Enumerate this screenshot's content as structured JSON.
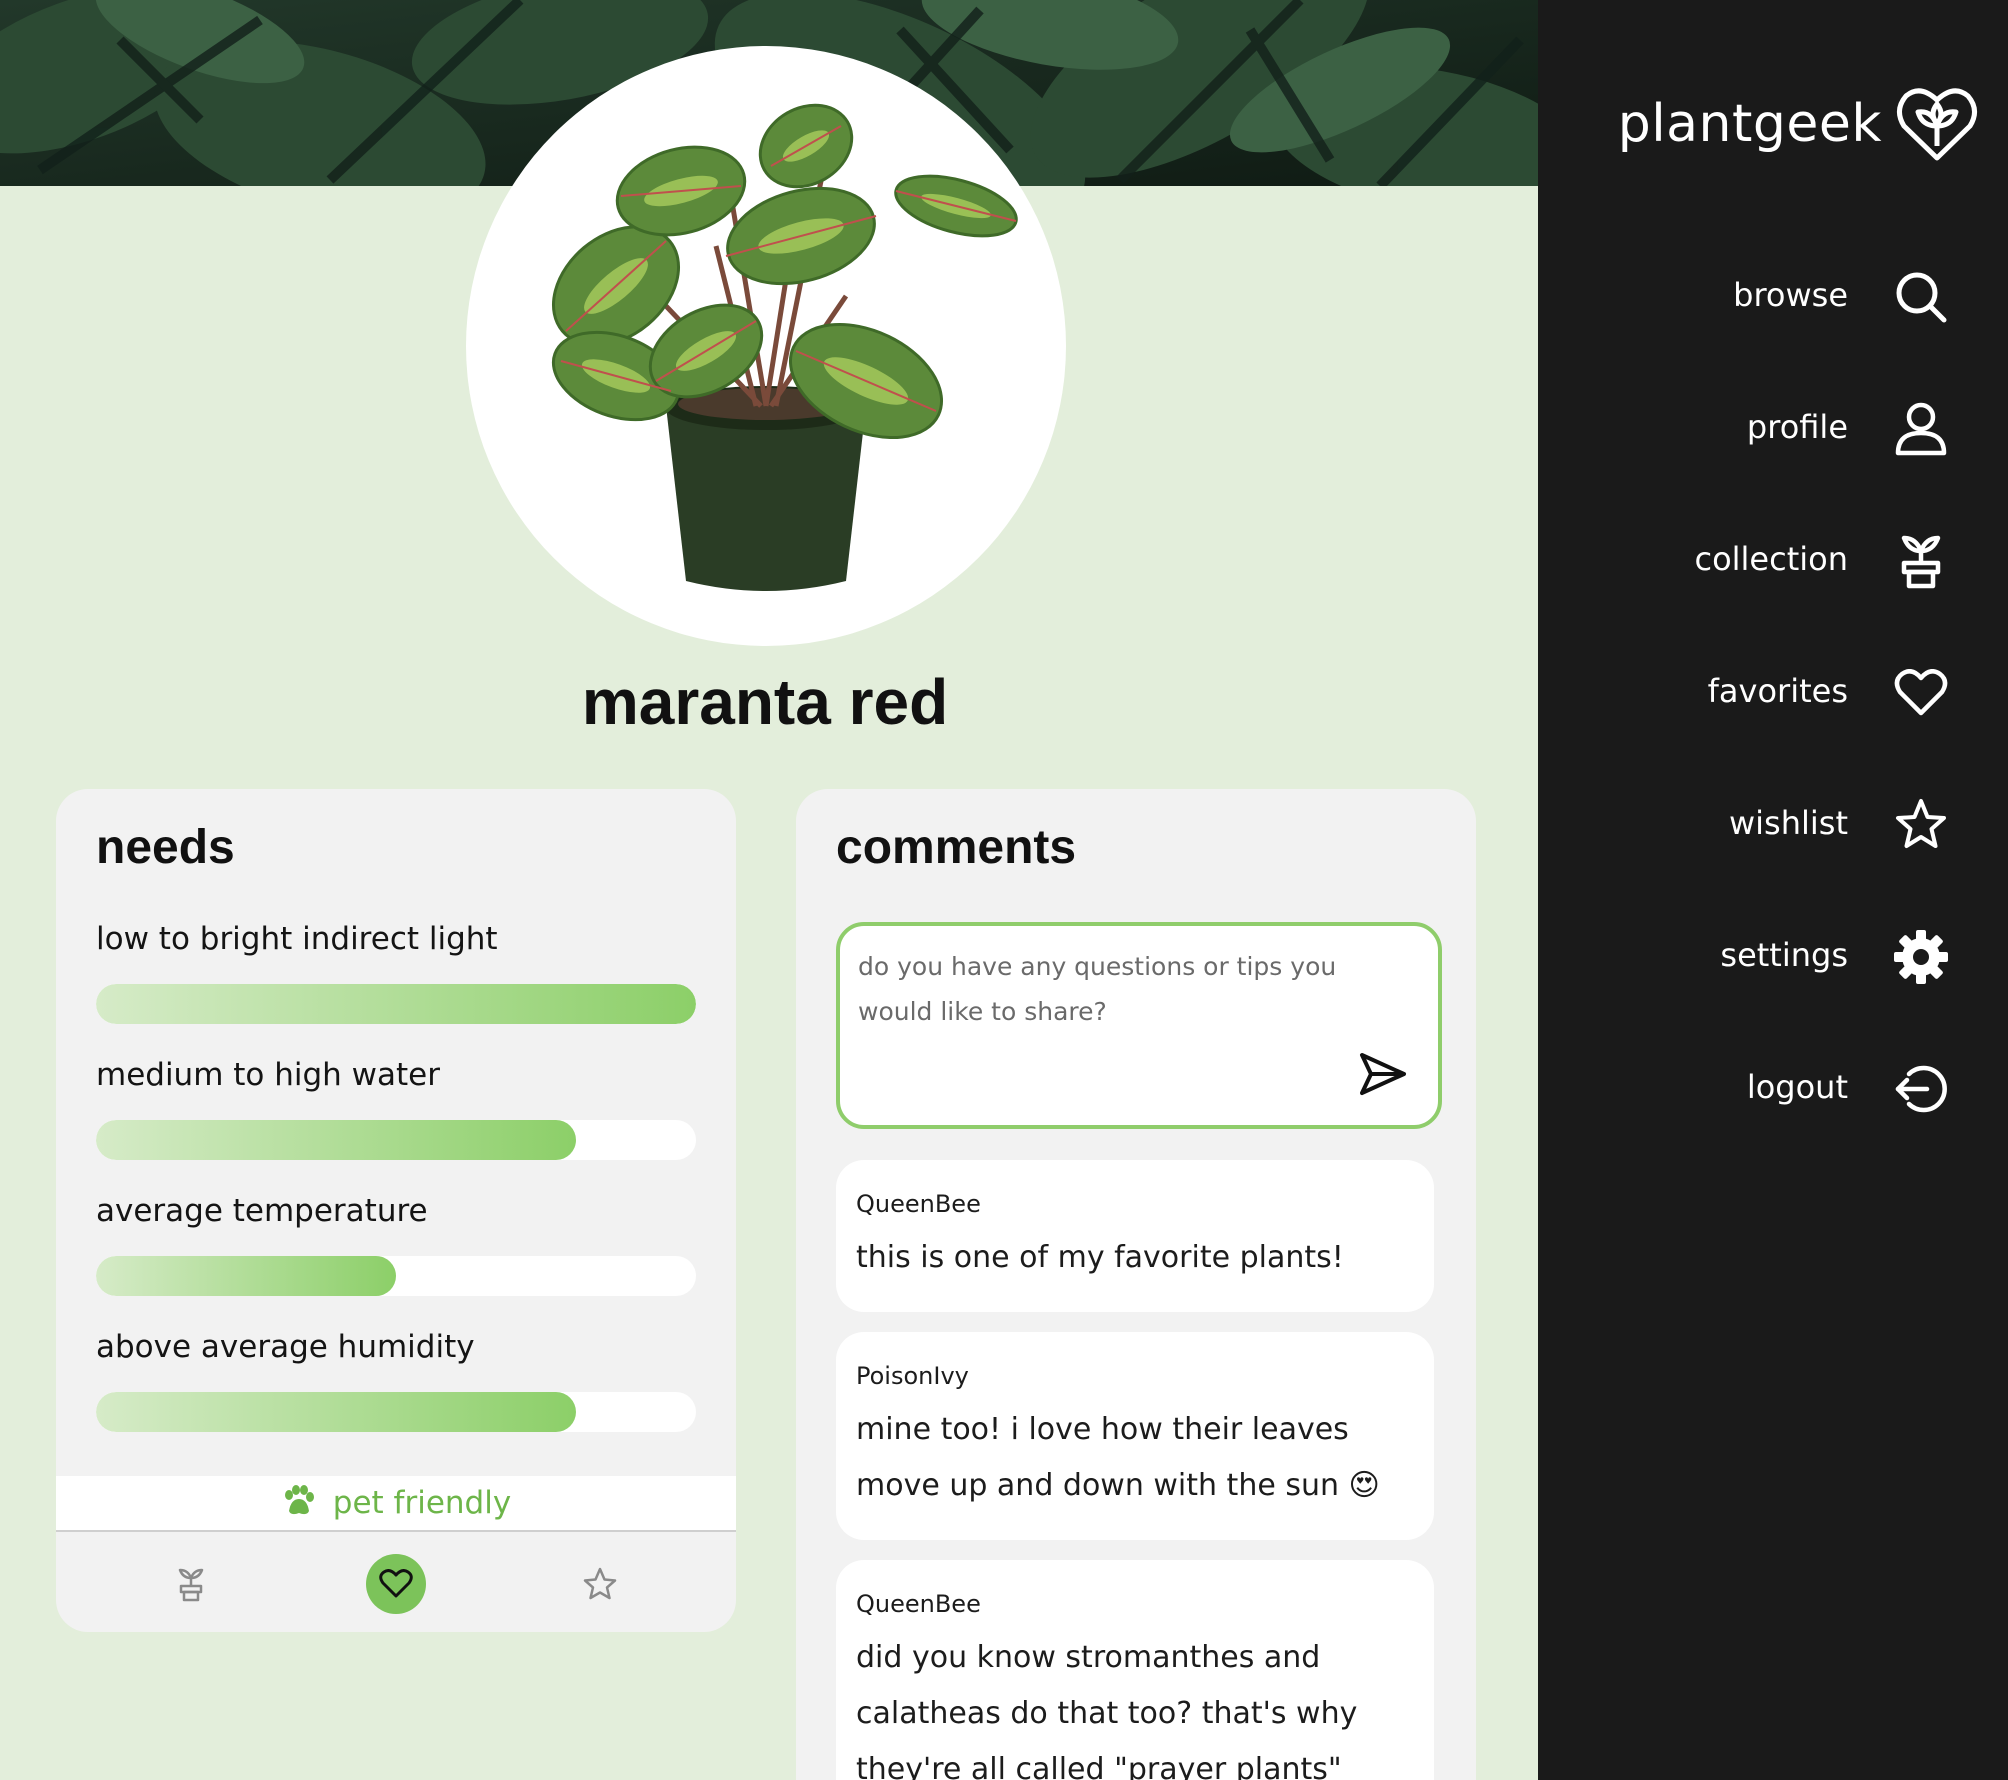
{
  "plant": {
    "name": "maranta red"
  },
  "needs": {
    "heading": "needs",
    "items": [
      {
        "label": "low to bright indirect light",
        "level": 1.0
      },
      {
        "label": "medium to high water",
        "level": 0.8
      },
      {
        "label": "average temperature",
        "level": 0.5
      },
      {
        "label": "above average humidity",
        "level": 0.8
      }
    ],
    "pet_friendly": "pet friendly",
    "actions": [
      {
        "name": "collection",
        "icon": "plant-pot-icon",
        "active": false
      },
      {
        "name": "favorites",
        "icon": "heart-icon",
        "active": true
      },
      {
        "name": "wishlist",
        "icon": "star-icon",
        "active": false
      }
    ]
  },
  "comments": {
    "heading": "comments",
    "placeholder": "do you have any questions or tips you would like to share?",
    "list": [
      {
        "author": "QueenBee",
        "text": "this is one of my favorite plants!"
      },
      {
        "author": "PoisonIvy",
        "text": "mine too! i love how their leaves move up and down with the sun 😍"
      },
      {
        "author": "QueenBee",
        "text": "did you know stromanthes and calatheas do that too? that's why they're all called \"prayer plants\""
      }
    ]
  },
  "sidebar": {
    "brand": "plantgeek",
    "items": [
      {
        "label": "browse",
        "icon": "search-icon"
      },
      {
        "label": "profile",
        "icon": "user-icon"
      },
      {
        "label": "collection",
        "icon": "plant-pot-icon"
      },
      {
        "label": "favorites",
        "icon": "heart-icon"
      },
      {
        "label": "wishlist",
        "icon": "star-icon"
      },
      {
        "label": "settings",
        "icon": "gear-icon"
      },
      {
        "label": "logout",
        "icon": "logout-icon"
      }
    ]
  },
  "colors": {
    "sidebar_bg": "#1a1a1a",
    "page_bg": "#e3eedb",
    "accent_green": "#7cc35a",
    "card_bg": "#f2f2f2"
  }
}
